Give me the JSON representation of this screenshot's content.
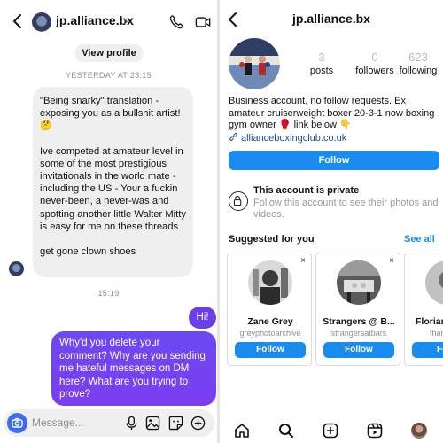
{
  "dm": {
    "header": {
      "name": "jp.alliance.bx",
      "chevron": "›"
    },
    "view_profile_label": "View profile",
    "timestamp_1": "YESTERDAY AT 23:15",
    "incoming_message": [
      "\"Being snarky\" translation - exposing you as a bullshit artist! 🤔",
      "Ive competed at amateur level in some of the most prestigious invitationals in the world mate - including the US - Your a fuckin never-been, a never-was and spotting another little Walter Mitty is easy for me on these threads",
      "get gone clown shoes"
    ],
    "timestamp_2": "15:19",
    "outgoing_short": "Hi!",
    "outgoing_long": "Why'd you delete your comment? Why are you sending me hateful messages on DM here? What are you trying to prove?",
    "composer_placeholder": "Message...",
    "icons": [
      "back-arrow-icon",
      "phone-icon",
      "video-camera-icon",
      "camera-icon",
      "microphone-icon",
      "image-icon",
      "sticker-icon",
      "plus-icon"
    ]
  },
  "profile": {
    "username": "jp.alliance.bx",
    "stats": [
      {
        "value": "3",
        "label": "posts"
      },
      {
        "value": "0",
        "label": "followers"
      },
      {
        "value": "623",
        "label": "following"
      }
    ],
    "bio": "Business account, no follow requests. Ex amateur cruiserweight boxer 20-3-1 now boxing gym owner 🥊 link below 👇",
    "link": "allianceboxingclub.co.uk",
    "follow_label": "Follow",
    "private_title": "This account is private",
    "private_sub": "Follow this account to see their photos and videos.",
    "suggested_title": "Suggested for you",
    "see_all": "See all",
    "suggestions": [
      {
        "name": "Zane Grey",
        "handle": "greyphotoarchive",
        "close": "×",
        "follow": "Follow"
      },
      {
        "name": "Strangers @ B...",
        "handle": "strangersatbars",
        "close": "×",
        "follow": "Follow"
      },
      {
        "name": "Florian I",
        "handle": "fhar",
        "close": "×",
        "follow": "Follo"
      }
    ],
    "nav_icons": [
      "home-icon",
      "search-icon",
      "create-icon",
      "reels-icon",
      "profile-avatar"
    ]
  },
  "colors": {
    "accent_blue": "#1a8cf0",
    "outgoing_bubble": "#6c49f0",
    "incoming_bubble": "#efefef",
    "link": "#1c4e98"
  }
}
